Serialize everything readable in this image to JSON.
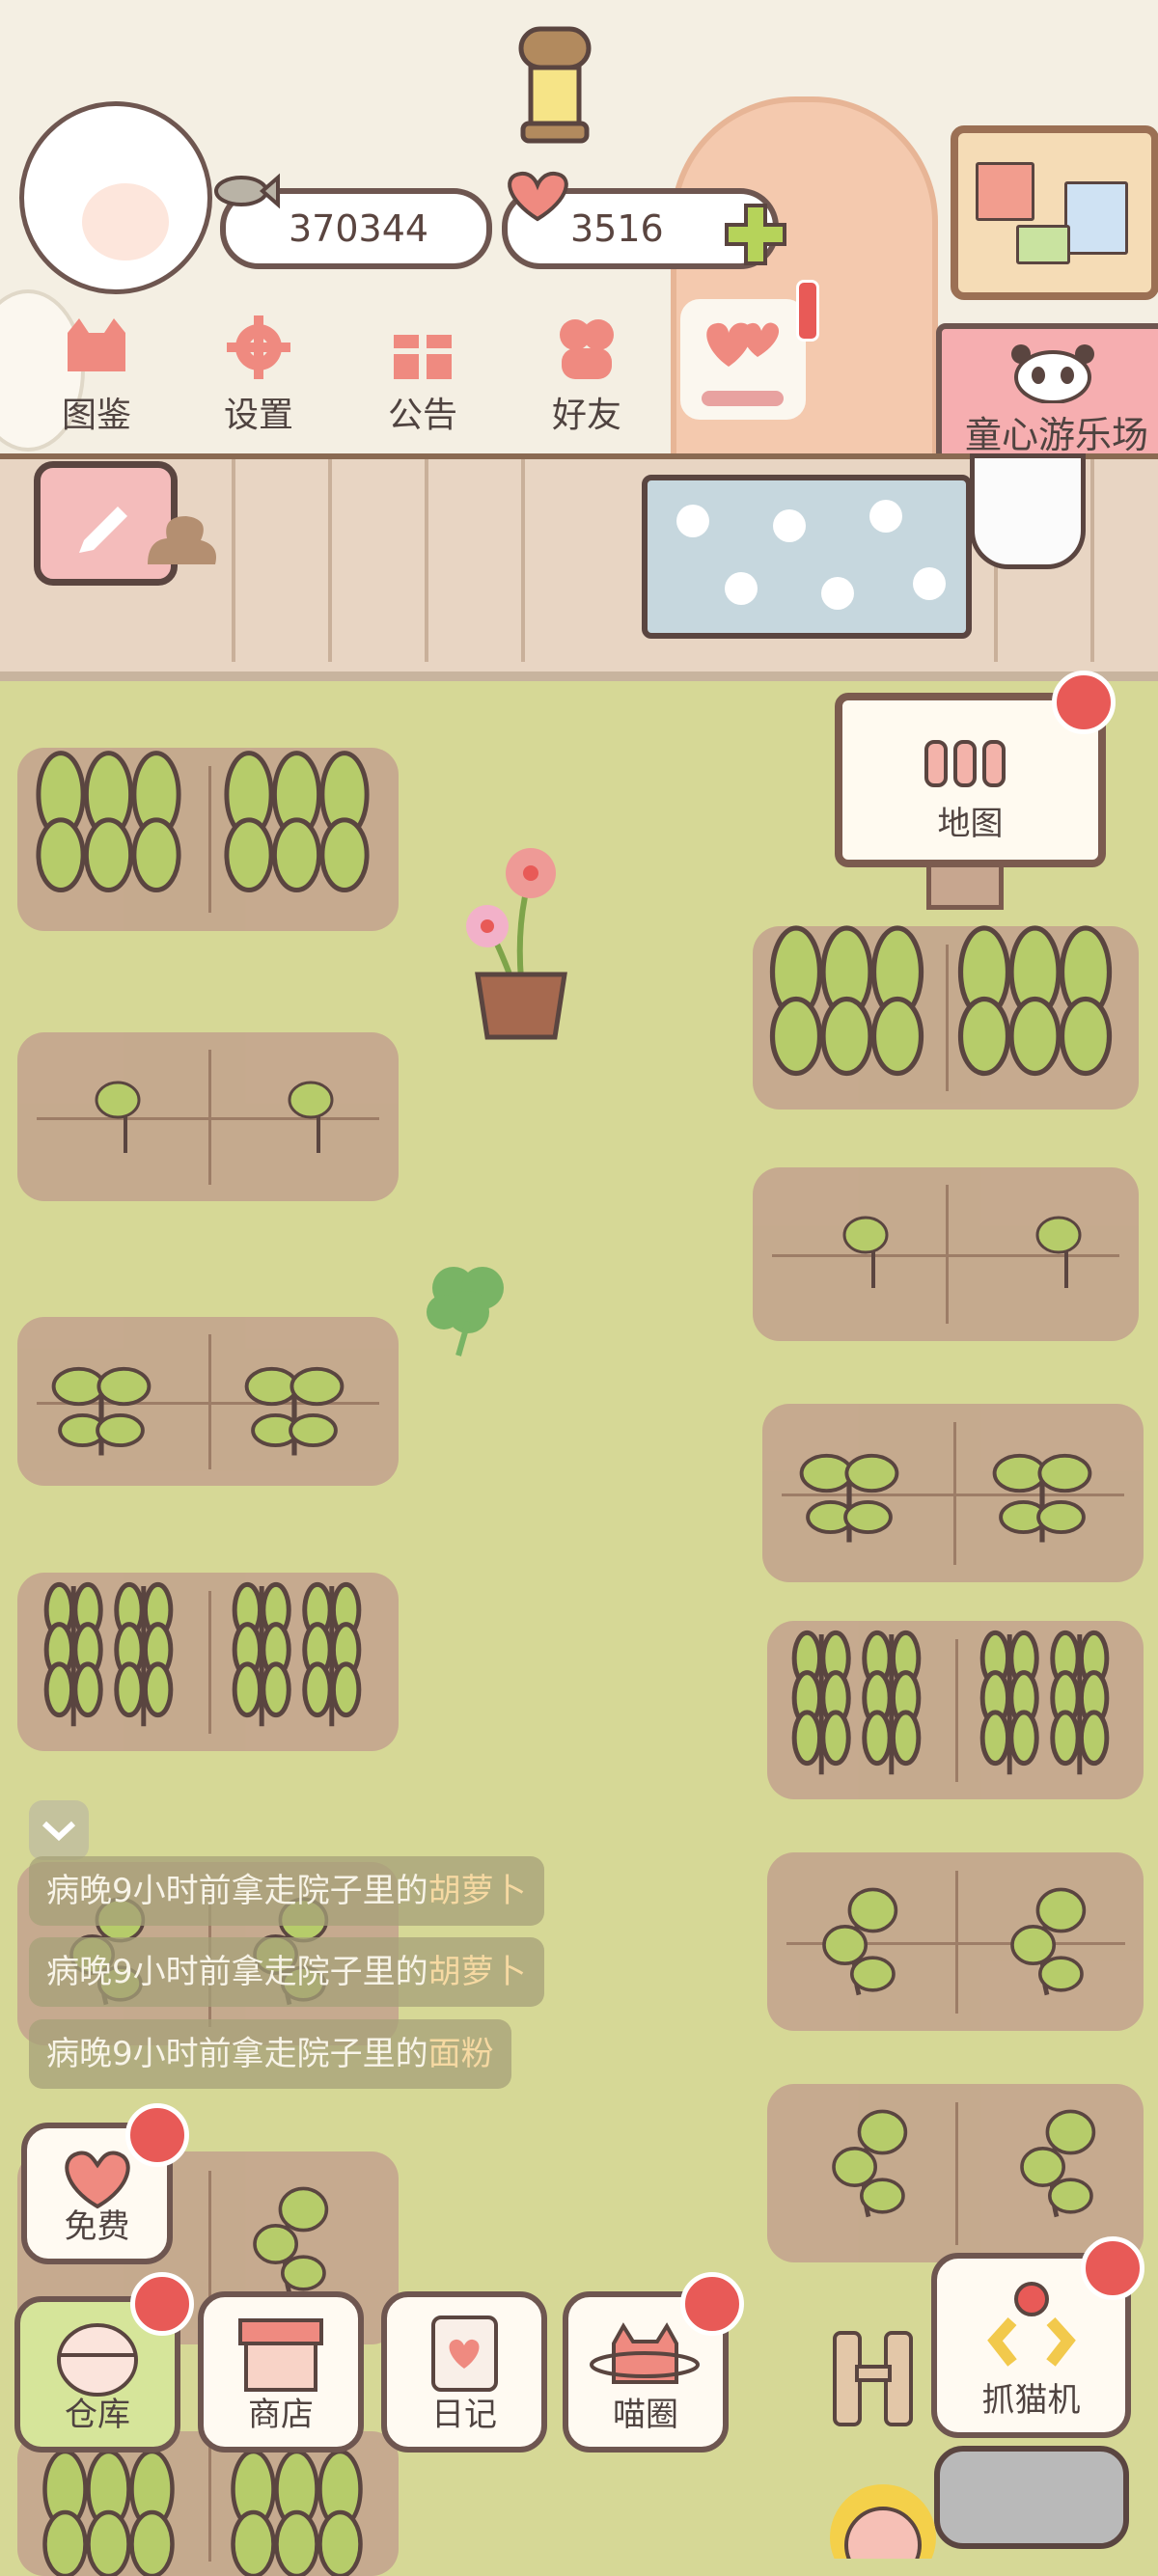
{
  "currencies": {
    "fish": "370344",
    "hearts": "3516"
  },
  "nav": [
    {
      "label": "图鉴"
    },
    {
      "label": "设置"
    },
    {
      "label": "公告"
    },
    {
      "label": "好友"
    }
  ],
  "signs": {
    "park": "童心游乐场",
    "map": "地图"
  },
  "messages": [
    {
      "text": "病晚9小时前拿走院子里的",
      "item": "胡萝卜"
    },
    {
      "text": "病晚9小时前拿走院子里的",
      "item": "胡萝卜"
    },
    {
      "text": "病晚9小时前拿走院子里的",
      "item": "面粉"
    }
  ],
  "bottom": {
    "free": "免费",
    "warehouse": "仓库",
    "shop": "商店",
    "diary": "日记",
    "meow": "喵圈",
    "claw": "抓猫机"
  },
  "colors": {
    "grass": "#d6d896",
    "soil": "#c5a88e",
    "badge": "#e85a57",
    "leaf": "#b6cc6a",
    "outline": "#5a4540"
  }
}
